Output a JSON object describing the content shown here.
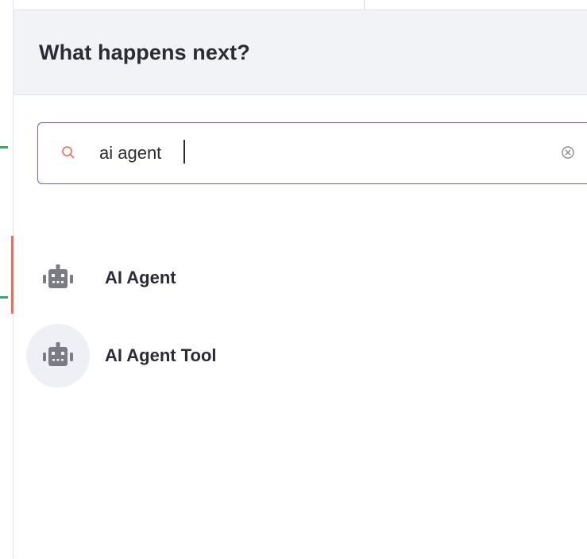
{
  "panel": {
    "title": "What happens next?"
  },
  "search": {
    "value": "ai agent",
    "icon": "search-icon",
    "clear_icon": "clear-icon"
  },
  "results": [
    {
      "label": "AI Agent",
      "icon": "robot-icon",
      "hovered": false
    },
    {
      "label": "AI Agent Tool",
      "icon": "robot-icon",
      "hovered": true
    }
  ],
  "colors": {
    "accent": "#6b5bd6",
    "search_icon": "#ef6b5c",
    "header_bg": "#f2f3f7",
    "icon_gray": "#7a7b85"
  }
}
